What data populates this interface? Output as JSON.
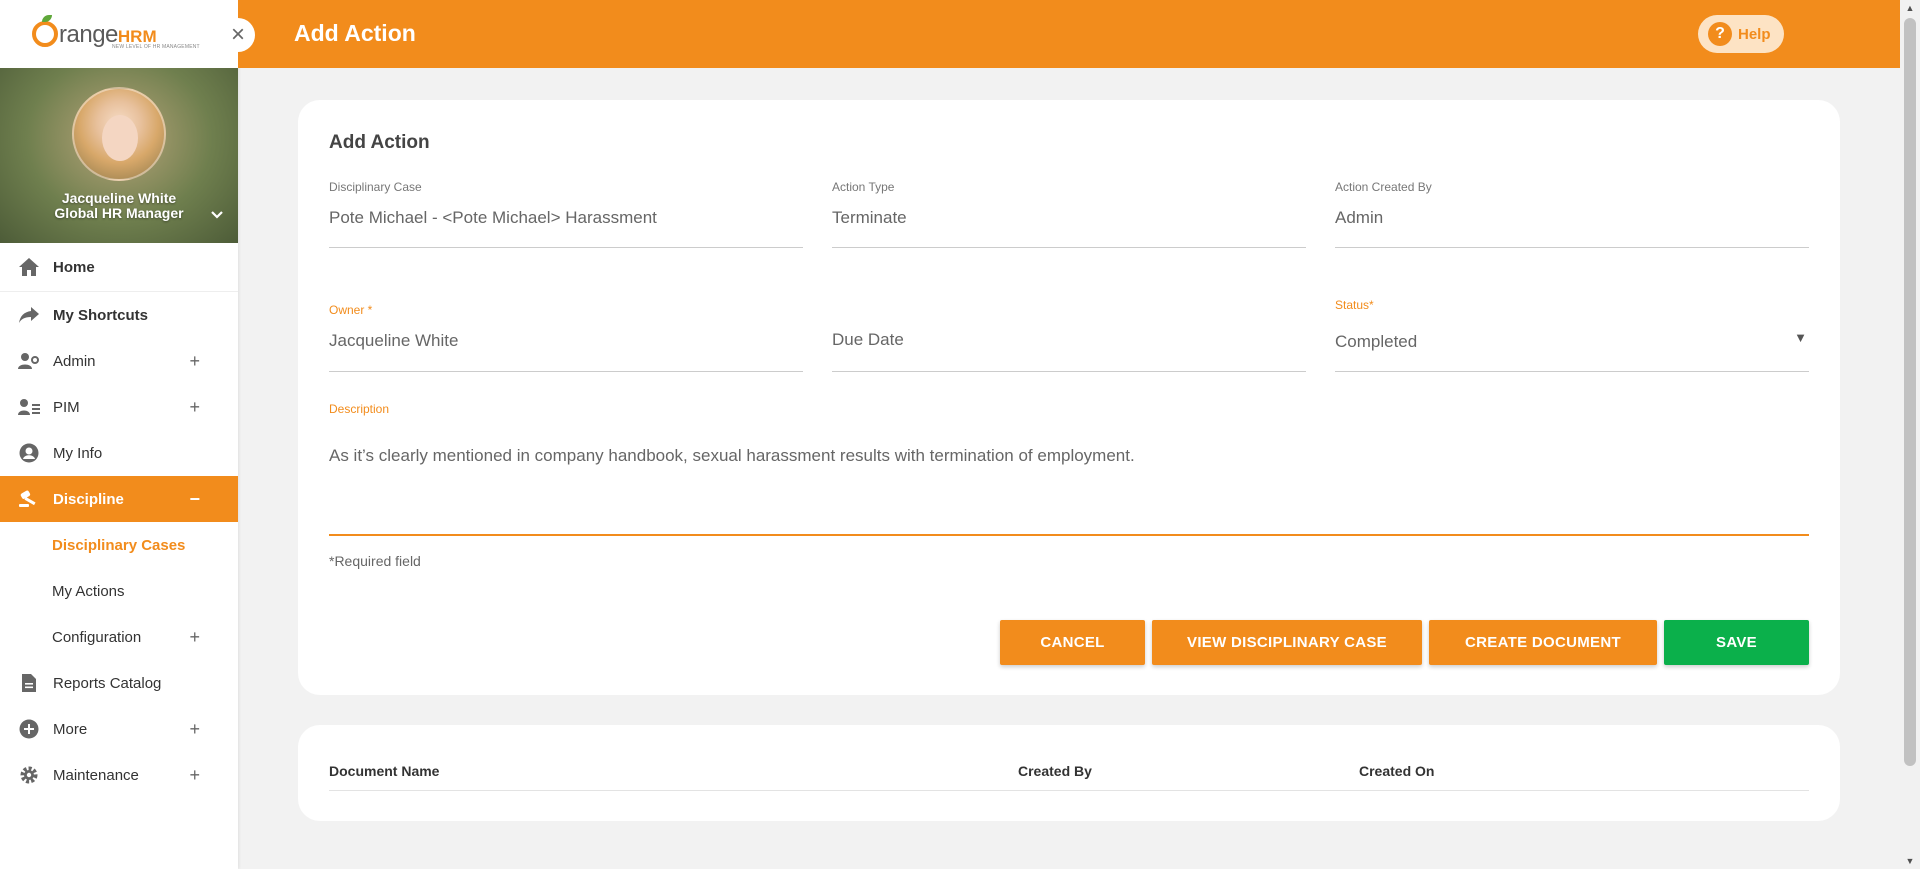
{
  "app": {
    "logo_text": "range",
    "logo_hrm": "HRM",
    "logo_tagline": "NEW LEVEL OF HR MANAGEMENT"
  },
  "profile": {
    "name": "Jacqueline White",
    "role": "Global HR Manager"
  },
  "sidebar": {
    "items": [
      {
        "label": "Home"
      },
      {
        "label": "My Shortcuts"
      },
      {
        "label": "Admin"
      },
      {
        "label": "PIM"
      },
      {
        "label": "My Info"
      },
      {
        "label": "Discipline"
      },
      {
        "label": "Reports Catalog"
      },
      {
        "label": "More"
      },
      {
        "label": "Maintenance"
      }
    ],
    "sub_items": [
      {
        "label": "Disciplinary Cases"
      },
      {
        "label": "My Actions"
      },
      {
        "label": "Configuration"
      }
    ]
  },
  "header": {
    "title": "Add Action",
    "help_label": "Help"
  },
  "form": {
    "title": "Add Action",
    "disciplinary_case": {
      "label": "Disciplinary Case",
      "value": "Pote Michael - <Pote Michael> Harassment"
    },
    "action_type": {
      "label": "Action Type",
      "value": "Terminate"
    },
    "action_created_by": {
      "label": "Action Created By",
      "value": "Admin"
    },
    "owner": {
      "label": "Owner *",
      "value": "Jacqueline White"
    },
    "due_date": {
      "placeholder": "Due Date"
    },
    "status": {
      "label": "Status*",
      "value": "Completed"
    },
    "description": {
      "label": "Description",
      "value": "As it’s clearly mentioned in company handbook, sexual harassment results with termination of employment."
    },
    "required_note": "*Required field"
  },
  "buttons": {
    "cancel": "CANCEL",
    "view_case": "VIEW DISCIPLINARY CASE",
    "create_document": "CREATE DOCUMENT",
    "save": "SAVE"
  },
  "documents": {
    "columns": [
      "Document Name",
      "Created By",
      "Created On"
    ]
  },
  "colors": {
    "accent": "#f28c1c",
    "save": "#0bb04b"
  }
}
